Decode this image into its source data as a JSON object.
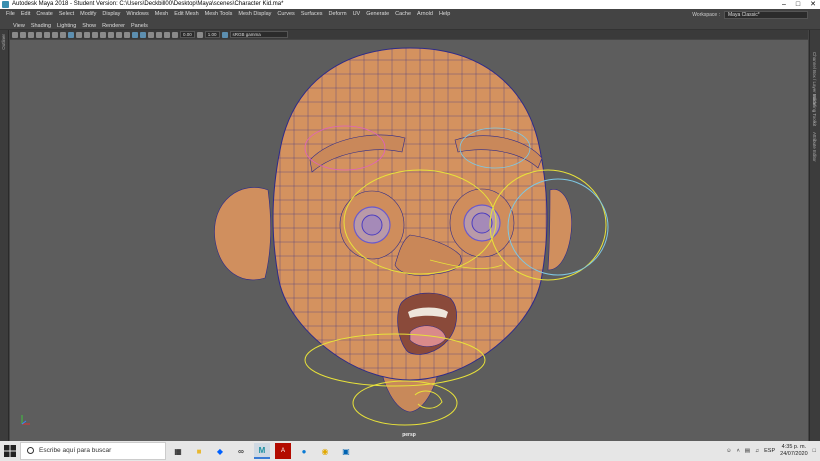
{
  "window": {
    "title": "Autodesk Maya 2018 - Student Version: C:\\Users\\Deckbill00\\Desktop\\Maya\\scenes\\Character Kid.ma*",
    "min_icon": "minimize-icon",
    "max_icon": "maximize-icon",
    "close_icon": "close-icon"
  },
  "menubar": {
    "items": [
      "File",
      "Edit",
      "Create",
      "Select",
      "Modify",
      "Display",
      "Windows",
      "Mesh",
      "Edit Mesh",
      "Mesh Tools",
      "Mesh Display",
      "Curves",
      "Surfaces",
      "Deform",
      "UV",
      "Generate",
      "Cache",
      "Arnold",
      "Help"
    ],
    "workspace_label": "Workspace :",
    "workspace_value": "Maya Classic*"
  },
  "left_panel": {
    "label": "Outliner"
  },
  "right_panel": {
    "labels": [
      "Channel Box / Layer Editor",
      "Modeling Toolkit",
      "Attribute Editor"
    ]
  },
  "panel_menu": {
    "items": [
      "View",
      "Shading",
      "Lighting",
      "Show",
      "Renderer",
      "Panels"
    ]
  },
  "panel_toolbar": {
    "field1": "0.00",
    "field2": "1.00",
    "colorspace": "sRGB gamma"
  },
  "viewport": {
    "camera_label": "persp",
    "colors": {
      "background": "#5d5d5d",
      "skin": "#d4925f",
      "wire": "#2e2b8a",
      "control_yellow": "#e8e23a",
      "control_blue": "#7ec8e3",
      "control_pink": "#e060c0"
    }
  },
  "taskbar": {
    "search_placeholder": "Escribe aquí para buscar",
    "apps": [
      "task-view-icon",
      "file-explorer-icon",
      "dropbox-icon",
      "infinity-icon",
      "maya-icon",
      "acrobat-icon",
      "edge-icon",
      "chrome-icon",
      "store-icon"
    ],
    "language": "ESP",
    "time": "4:35 p. m.",
    "date": "24/07/2020"
  }
}
